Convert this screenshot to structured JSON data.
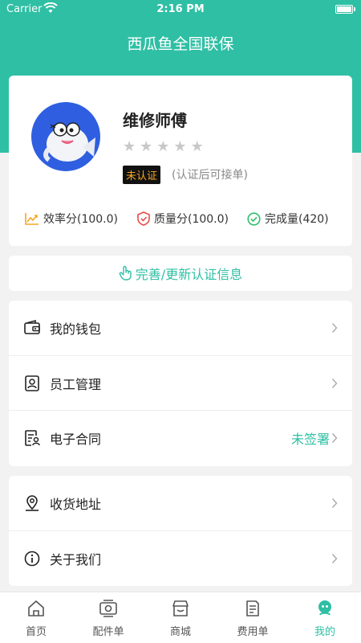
{
  "status_bar": {
    "carrier": "Carrier",
    "time": "2:16 PM"
  },
  "header": {
    "title": "西瓜鱼全国联保"
  },
  "profile": {
    "name": "维修师傅",
    "star_count": 5,
    "rating_filled": 0,
    "cert_badge": "未认证",
    "cert_note": "(认证后可接单)"
  },
  "metrics": [
    {
      "icon": "chart-icon",
      "label": "效率分(100.0)",
      "color": "#f5a623"
    },
    {
      "icon": "shield-icon",
      "label": "质量分(100.0)",
      "color": "#e94b4b"
    },
    {
      "icon": "check-circle-icon",
      "label": "完成量(420)",
      "color": "#2fbf6b"
    }
  ],
  "update_action": {
    "label": "完善/更新认证信息"
  },
  "menu_group_1": [
    {
      "label": "我的钱包",
      "icon": "wallet-icon",
      "status": ""
    },
    {
      "label": "员工管理",
      "icon": "employee-icon",
      "status": ""
    },
    {
      "label": "电子合同",
      "icon": "contract-icon",
      "status": "未签署"
    }
  ],
  "menu_group_2": [
    {
      "label": "收货地址",
      "icon": "location-icon",
      "status": ""
    },
    {
      "label": "关于我们",
      "icon": "info-icon",
      "status": ""
    }
  ],
  "tabs": [
    {
      "label": "首页",
      "icon": "home-icon",
      "active": false
    },
    {
      "label": "配件单",
      "icon": "parts-order-icon",
      "active": false
    },
    {
      "label": "商城",
      "icon": "store-icon",
      "active": false
    },
    {
      "label": "费用单",
      "icon": "bill-icon",
      "active": false
    },
    {
      "label": "我的",
      "icon": "profile-icon",
      "active": true
    }
  ],
  "colors": {
    "accent": "#2fbfa4",
    "badge_text": "#f5a623",
    "badge_bg": "#111111",
    "avatar_bg": "#2f5fe0"
  }
}
